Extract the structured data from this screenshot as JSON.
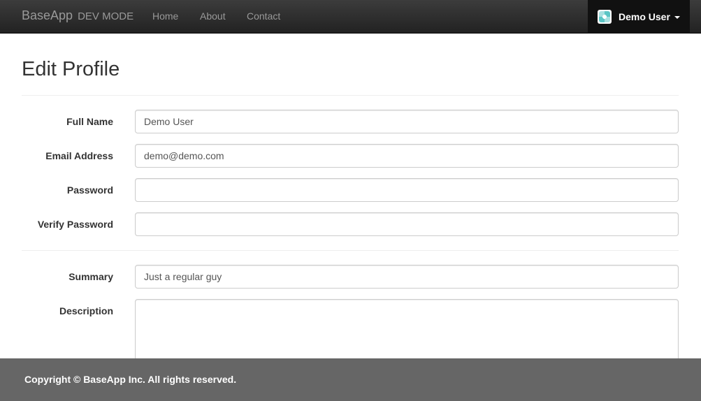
{
  "navbar": {
    "brand": "BaseApp",
    "brand_mode": "DEV MODE",
    "links": {
      "home": "Home",
      "about": "About",
      "contact": "Contact"
    },
    "user": {
      "name": "Demo User",
      "avatar_icon": "identicon-avatar-icon",
      "caret_icon": "caret-down-icon"
    }
  },
  "page": {
    "title": "Edit Profile"
  },
  "form": {
    "full_name": {
      "label": "Full Name",
      "value": "Demo User"
    },
    "email": {
      "label": "Email Address",
      "value": "demo@demo.com"
    },
    "password": {
      "label": "Password",
      "value": ""
    },
    "verify_password": {
      "label": "Verify Password",
      "value": ""
    },
    "summary": {
      "label": "Summary",
      "value": "Just a regular guy"
    },
    "description": {
      "label": "Description",
      "value": ""
    }
  },
  "footer": {
    "text": "Copyright © BaseApp Inc. All rights reserved."
  },
  "colors": {
    "navbar_bg": "#222222",
    "footer_bg": "#666666",
    "avatar_accent": "#5cc5c5"
  }
}
